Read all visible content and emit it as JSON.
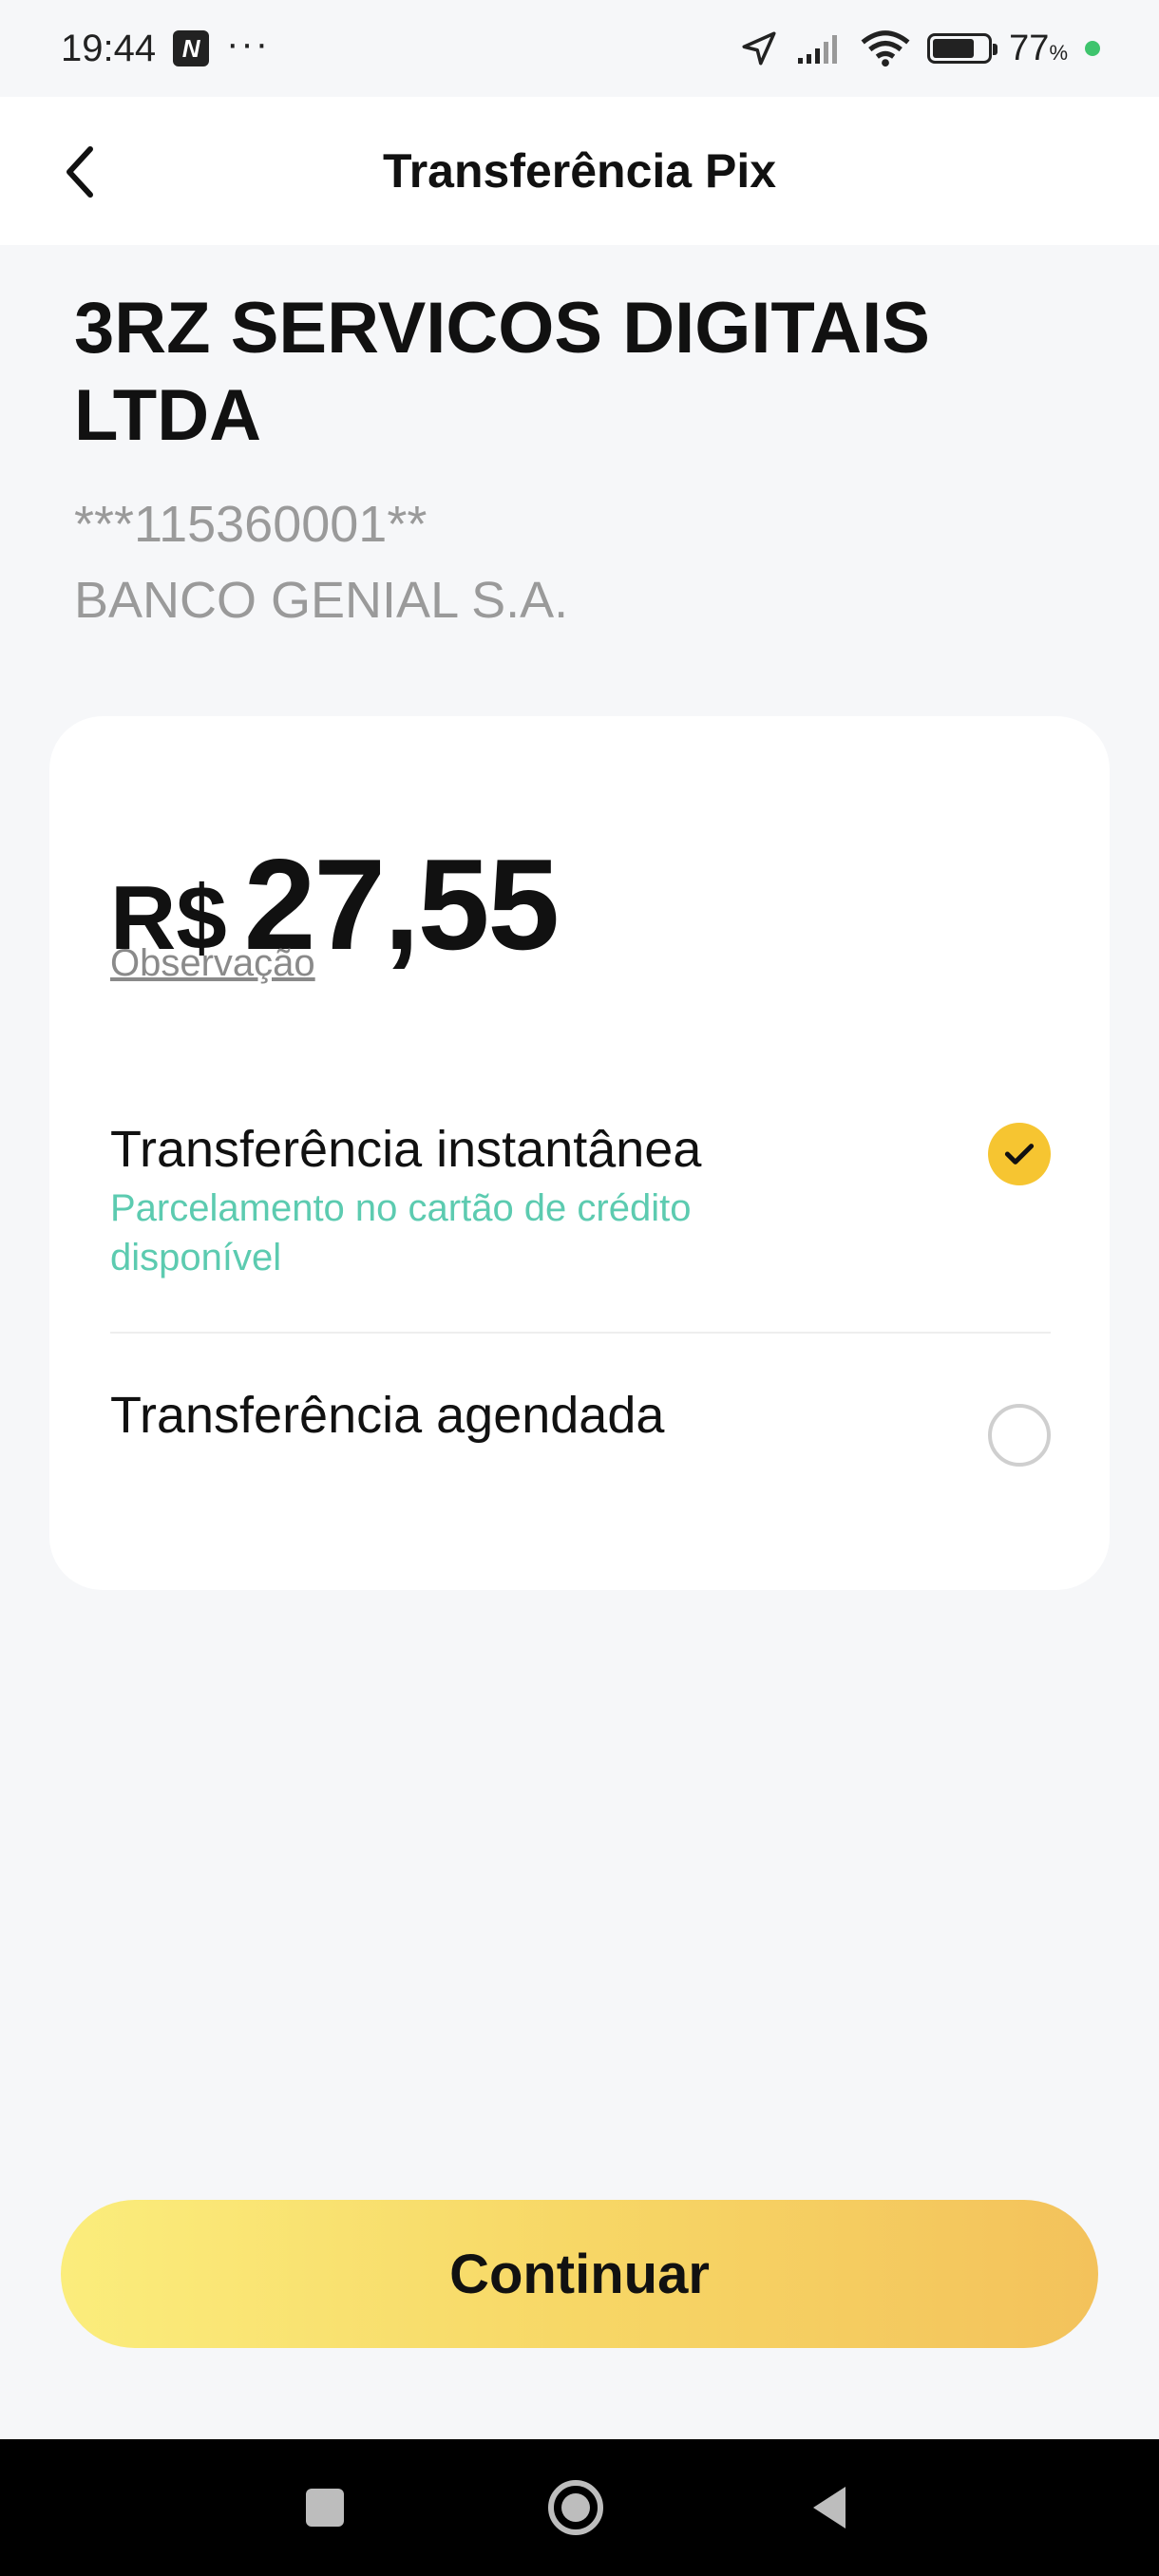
{
  "status_bar": {
    "time": "19:44",
    "app_icon_letter": "N",
    "more": "···",
    "battery_percent": "77",
    "battery_unit": "%",
    "battery_level": 0.77
  },
  "header": {
    "title": "Transferência Pix",
    "back_icon": "chevron-left-icon"
  },
  "recipient": {
    "name": "3RZ SERVICOS DIGITAIS LTDA",
    "document": "***115360001**",
    "bank": "BANCO GENIAL S.A."
  },
  "amount": {
    "currency": "R$",
    "value": "27,55",
    "note_link": "Observação"
  },
  "options": [
    {
      "title": "Transferência instantânea",
      "subtitle": "Parcelamento no cartão de crédito disponível",
      "selected": true
    },
    {
      "title": "Transferência agendada",
      "selected": false
    }
  ],
  "footer": {
    "continue_label": "Continuar"
  },
  "colors": {
    "accent_yellow": "#f6c531",
    "subtitle_green": "#5ccbb0",
    "button_gradient_start": "#fbed7c",
    "button_gradient_end": "#f3c25b"
  }
}
